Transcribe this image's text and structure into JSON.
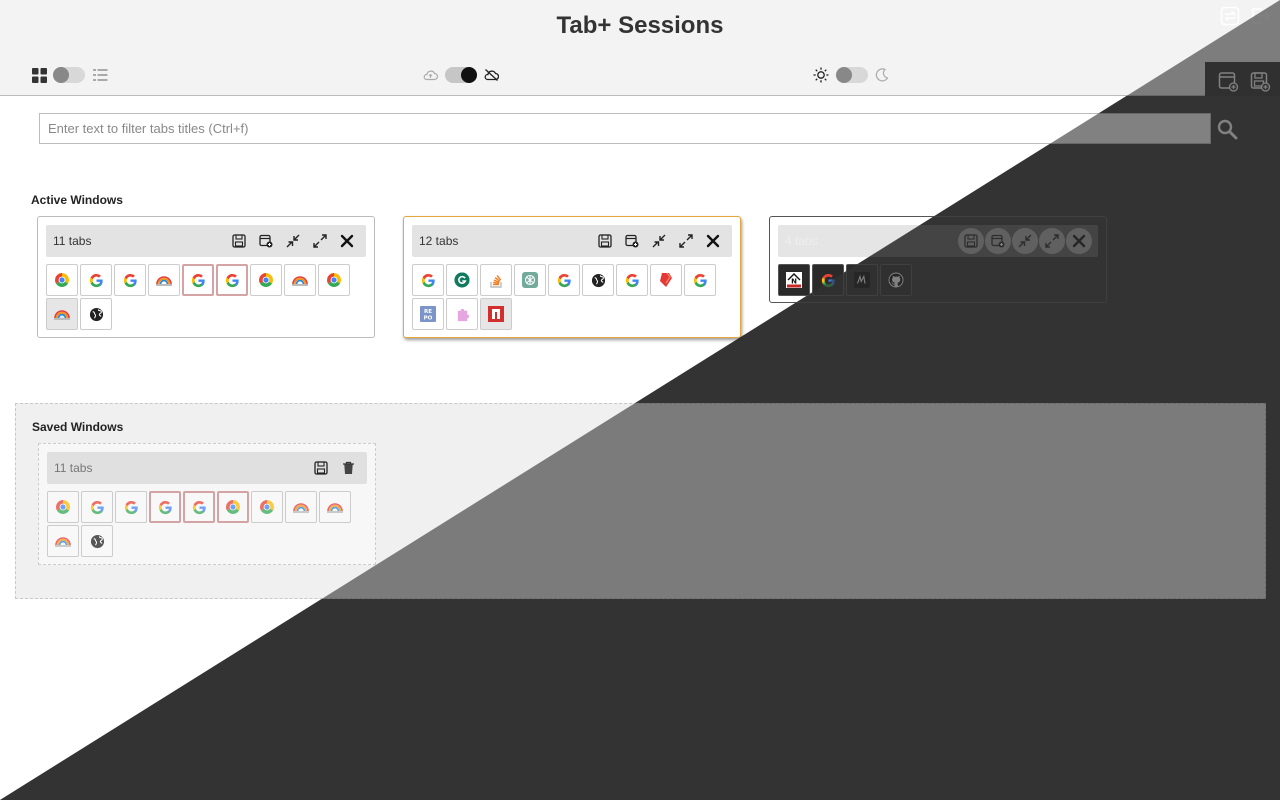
{
  "header": {
    "title": "Tab+ Sessions",
    "view_toggle": {
      "left_icon": "grid-icon",
      "right_icon": "list-icon",
      "state": "off"
    },
    "sync_toggle": {
      "left_icon": "cloud-icon",
      "right_icon": "cloud-off-icon",
      "state": "on"
    },
    "theme_toggle": {
      "left_icon": "sun-icon",
      "right_icon": "moon-icon",
      "state": "off"
    },
    "corner_icons": [
      "swap-icon",
      "exit-icon",
      "new-window-icon",
      "save-window-icon"
    ]
  },
  "search": {
    "placeholder": "Enter text to filter tabs titles (Ctrl+f)",
    "value": ""
  },
  "active": {
    "title": "Active Windows",
    "windows": [
      {
        "tab_count": "11 tabs",
        "focused": false,
        "tabs": [
          "chrome",
          "google",
          "google",
          "rainbow",
          "google",
          "google",
          "chrome",
          "rainbow",
          "chrome",
          "rainbow",
          "globe"
        ],
        "highlighted": [
          4,
          5
        ],
        "selected": [
          9
        ]
      },
      {
        "tab_count": "12 tabs",
        "focused": true,
        "tabs": [
          "google",
          "grammarly",
          "stackoverflow",
          "openai",
          "google",
          "globe",
          "google",
          "red-tag",
          "google",
          "repo",
          "puzzle",
          "red-n"
        ],
        "highlighted": [],
        "selected": [
          11
        ]
      },
      {
        "tab_count": "4 tabs",
        "focused": false,
        "tabs": [
          "news",
          "google",
          "medium",
          "github"
        ],
        "highlighted": [],
        "selected": []
      }
    ]
  },
  "saved": {
    "title": "Saved Windows",
    "windows": [
      {
        "tab_count": "11 tabs",
        "tabs": [
          "chrome",
          "google",
          "google",
          "google",
          "google",
          "chrome",
          "chrome",
          "rainbow",
          "rainbow",
          "rainbow",
          "globe"
        ],
        "highlighted": [
          3,
          4,
          5
        ]
      }
    ]
  },
  "colors": {
    "dark_bg": "#333333",
    "focus_border": "#e4a83c",
    "google_blue": "#4285F4",
    "google_red": "#EA4335",
    "google_yellow": "#FBBC05",
    "google_green": "#34A853"
  }
}
